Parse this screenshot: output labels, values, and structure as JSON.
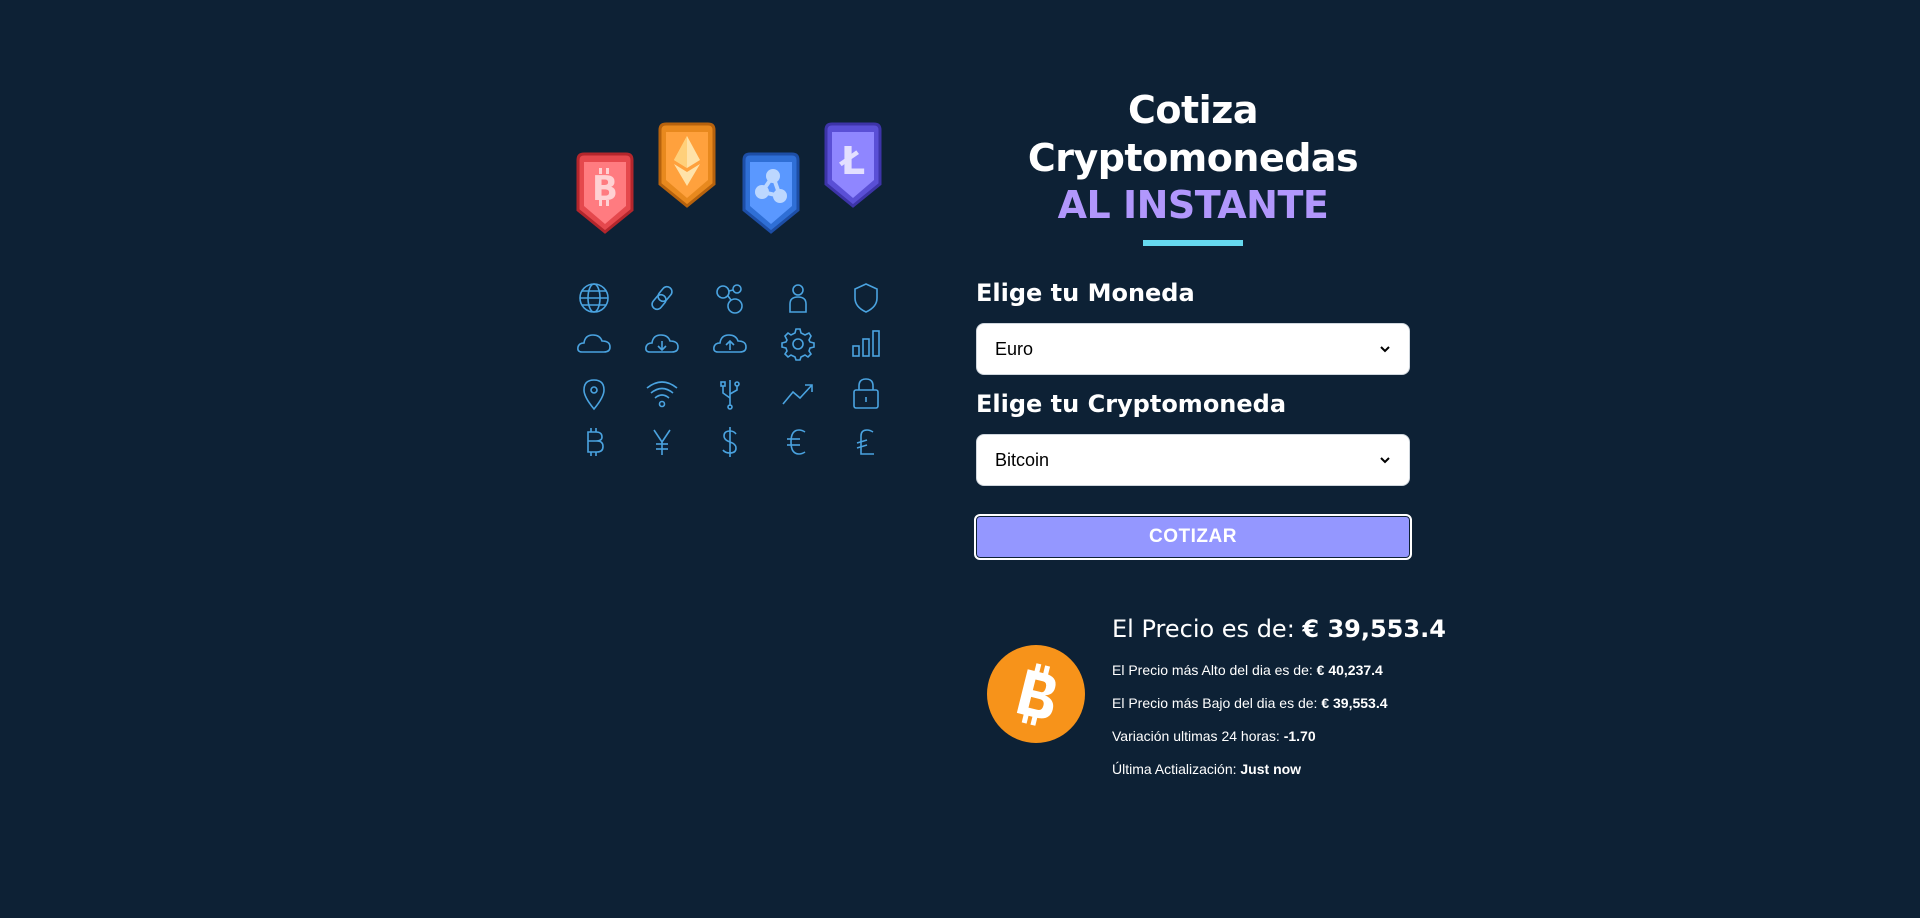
{
  "header": {
    "title_line1": "Cotiza Cryptomonedas",
    "title_line2": "AL INSTANTE"
  },
  "form": {
    "currency_label": "Elige tu Moneda",
    "currency_selected": "Euro",
    "crypto_label": "Elige tu Cryptomoneda",
    "crypto_selected": "Bitcoin",
    "submit_label": "COTIZAR"
  },
  "result": {
    "price_label": "El Precio es de: ",
    "price_value": "€ 39,553.4",
    "high_label": "El Precio más Alto del dia es de: ",
    "high_value": "€ 40,237.4",
    "low_label": "El Precio más Bajo del dia es de: ",
    "low_value": "€ 39,553.4",
    "change_label": "Variación ultimas 24 horas: ",
    "change_value": "-1.70",
    "updated_label": "Última Actialización: ",
    "updated_value": "Just now"
  },
  "illustration": {
    "coin_badges": [
      "bitcoin-badge-icon",
      "ethereum-badge-icon",
      "ripple-badge-icon",
      "litecoin-badge-icon"
    ],
    "icons": [
      "globe-icon",
      "chain-link-icon",
      "network-nodes-icon",
      "user-icon",
      "shield-icon",
      "cloud-icon",
      "cloud-download-icon",
      "cloud-upload-icon",
      "gear-icon",
      "bar-chart-icon",
      "location-pin-icon",
      "wifi-icon",
      "usb-icon",
      "trend-up-icon",
      "padlock-icon",
      "bitcoin-symbol-icon",
      "yen-symbol-icon",
      "dollar-symbol-icon",
      "euro-symbol-icon",
      "litecoin-symbol-icon"
    ]
  },
  "colors": {
    "background": "#0d2135",
    "accent_purple": "#b197fc",
    "underline_cyan": "#66d9ef",
    "button": "#9497ff",
    "icon_blue": "#4aa3e0",
    "bitcoin_orange": "#f7931a"
  }
}
